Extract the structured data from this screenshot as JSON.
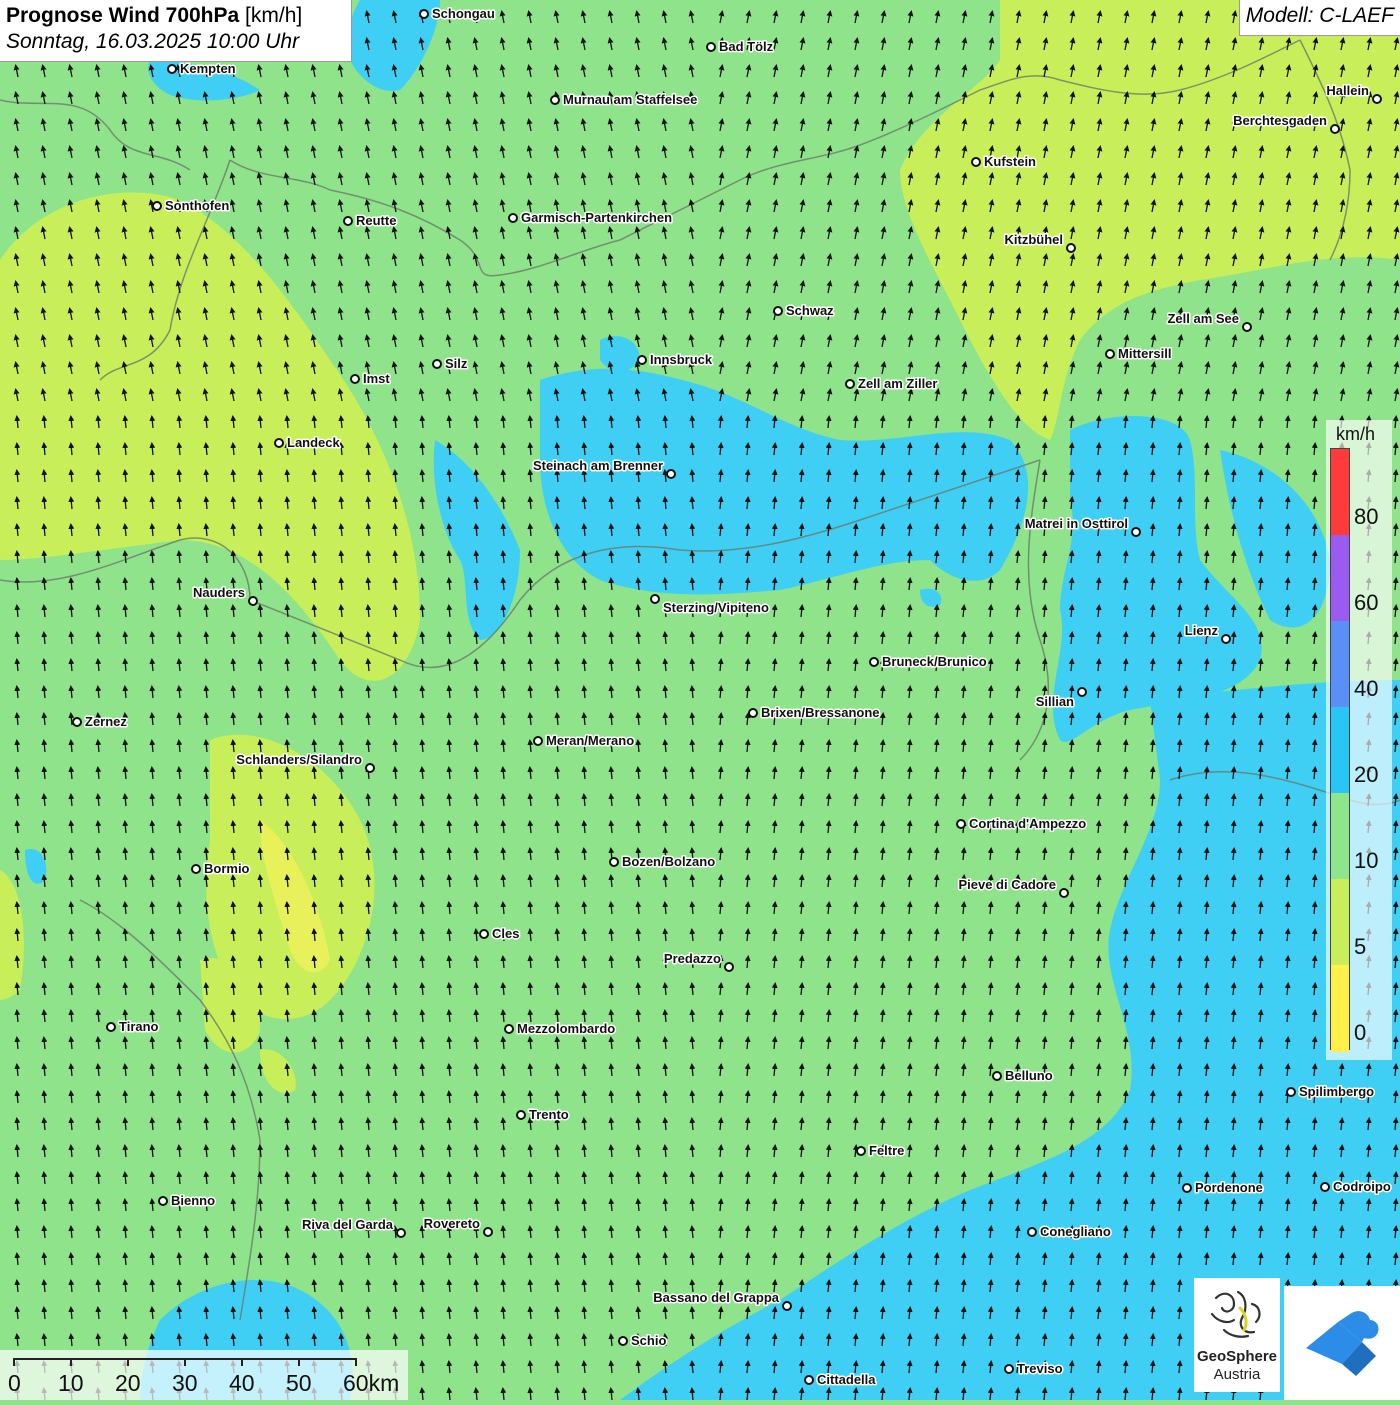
{
  "title": {
    "bold": "Prognose Wind 700hPa",
    "unit": " [km/h]",
    "date": "Sonntag, 16.03.2025 10:00 Uhr"
  },
  "model": "Modell: C-LAEF",
  "legend": {
    "unit": "km/h",
    "ticks": [
      "80",
      "60",
      "40",
      "20",
      "10",
      "5",
      "0"
    ],
    "colors": [
      "#ff3a3a",
      "#9b5af0",
      "#5a90f5",
      "#28c6f4",
      "#8ee68c",
      "#c8ef5a",
      "#fff14a"
    ]
  },
  "scalebar": {
    "labels": [
      "0",
      "10",
      "20",
      "30",
      "40",
      "50",
      "60km"
    ]
  },
  "logos": {
    "geosphere_line1": "GeoSphere",
    "geosphere_line2": "Austria"
  },
  "icons": {
    "geosphere": "geosphere-logo-icon",
    "wetter": "weather-app-logo-icon"
  },
  "cities": [
    {
      "name": "Schongau"
    },
    {
      "name": "Kempten"
    },
    {
      "name": "Bad Tölz"
    },
    {
      "name": "Murnau am Staffelsee"
    },
    {
      "name": "Hallein"
    },
    {
      "name": "Berchtesgaden"
    },
    {
      "name": "Kufstein"
    },
    {
      "name": "Sonthofen"
    },
    {
      "name": "Reutte"
    },
    {
      "name": "Garmisch-Partenkirchen"
    },
    {
      "name": "Kitzbühel"
    },
    {
      "name": "Schwaz"
    },
    {
      "name": "Zell am See"
    },
    {
      "name": "Innsbruck"
    },
    {
      "name": "Mittersill"
    },
    {
      "name": "Silz"
    },
    {
      "name": "Imst"
    },
    {
      "name": "Zell am Ziller"
    },
    {
      "name": "Landeck"
    },
    {
      "name": "Steinach am Brenner"
    },
    {
      "name": "Matrei in Osttirol"
    },
    {
      "name": "Nauders"
    },
    {
      "name": "Sterzing/Vipiteno"
    },
    {
      "name": "Lienz"
    },
    {
      "name": "Bruneck/Brunico"
    },
    {
      "name": "Sillian"
    },
    {
      "name": "Zernez"
    },
    {
      "name": "Brixen/Bressanone"
    },
    {
      "name": "Meran/Merano"
    },
    {
      "name": "Schlanders/Silandro"
    },
    {
      "name": "Cortina d'Ampezzo"
    },
    {
      "name": "Bozen/Bolzano"
    },
    {
      "name": "Bormio"
    },
    {
      "name": "Pieve di Cadore"
    },
    {
      "name": "Cles"
    },
    {
      "name": "Predazzo"
    },
    {
      "name": "Tirano"
    },
    {
      "name": "Mezzolombardo"
    },
    {
      "name": "Belluno"
    },
    {
      "name": "Spilimbergo"
    },
    {
      "name": "Trento"
    },
    {
      "name": "Feltre"
    },
    {
      "name": "Bienno"
    },
    {
      "name": "Pordenone"
    },
    {
      "name": "Codroipo"
    },
    {
      "name": "Riva del Garda"
    },
    {
      "name": "Rovereto"
    },
    {
      "name": "Conegliano"
    },
    {
      "name": "Bassano del Grappa"
    },
    {
      "name": "Schio"
    },
    {
      "name": "Treviso"
    },
    {
      "name": "Cittadella"
    }
  ]
}
